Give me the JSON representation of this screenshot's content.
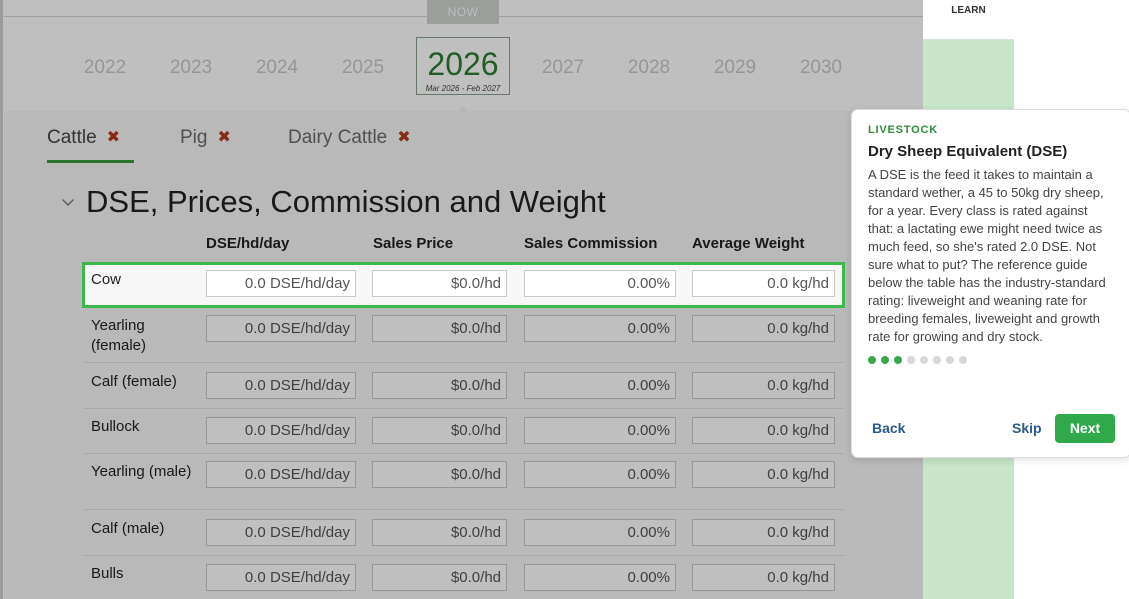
{
  "timeline": {
    "now_label": "NOW",
    "years": [
      "2022",
      "2023",
      "2024",
      "2025",
      "2026",
      "2027",
      "2028",
      "2029",
      "2030"
    ],
    "current_year": "2026",
    "current_range": "Mar 2026 - Feb 2027"
  },
  "tabs": [
    {
      "label": "Cattle",
      "active": true
    },
    {
      "label": "Pig",
      "active": false
    },
    {
      "label": "Dairy Cattle",
      "active": false
    }
  ],
  "tab_close_glyph": "✖",
  "section": {
    "title": "DSE, Prices, Commission and Weight",
    "columns": [
      "DSE/hd/day",
      "Sales Price",
      "Sales Commission",
      "Average Weight"
    ],
    "rows": [
      {
        "label": "Cow",
        "dse": "0.0 DSE/hd/day",
        "price": "$0.0/hd",
        "commission": "0.00%",
        "weight": "0.0 kg/hd"
      },
      {
        "label": "Yearling (female)",
        "dse": "0.0 DSE/hd/day",
        "price": "$0.0/hd",
        "commission": "0.00%",
        "weight": "0.0 kg/hd"
      },
      {
        "label": "Calf (female)",
        "dse": "0.0 DSE/hd/day",
        "price": "$0.0/hd",
        "commission": "0.00%",
        "weight": "0.0 kg/hd"
      },
      {
        "label": "Bullock",
        "dse": "0.0 DSE/hd/day",
        "price": "$0.0/hd",
        "commission": "0.00%",
        "weight": "0.0 kg/hd"
      },
      {
        "label": "Yearling (male)",
        "dse": "0.0 DSE/hd/day",
        "price": "$0.0/hd",
        "commission": "0.00%",
        "weight": "0.0 kg/hd"
      },
      {
        "label": "Calf (male)",
        "dse": "0.0 DSE/hd/day",
        "price": "$0.0/hd",
        "commission": "0.00%",
        "weight": "0.0 kg/hd"
      },
      {
        "label": "Bulls",
        "dse": "0.0 DSE/hd/day",
        "price": "$0.0/hd",
        "commission": "0.00%",
        "weight": "0.0 kg/hd"
      }
    ]
  },
  "sidebar": {
    "learn_label": "LEARN"
  },
  "tour": {
    "eyebrow": "LIVESTOCK",
    "title": "Dry Sheep Equivalent (DSE)",
    "body": "A DSE is the feed it takes to maintain a standard wether, a 45 to 50kg dry sheep, for a year. Every class is rated against that: a lactating ewe might need twice as much feed, so she's rated 2.0 DSE. Not sure what to put? The reference guide below the table has the industry-standard rating: liveweight and weaning rate for breeding females, liveweight and growth rate for growing and dry stock.",
    "step": 3,
    "total_steps": 8,
    "back_label": "Back",
    "skip_label": "Skip",
    "next_label": "Next"
  },
  "colors": {
    "accent": "#2fa94a",
    "sidebar": "#c8e6c9",
    "link": "#2a5b8c",
    "close": "#b03a1f"
  }
}
